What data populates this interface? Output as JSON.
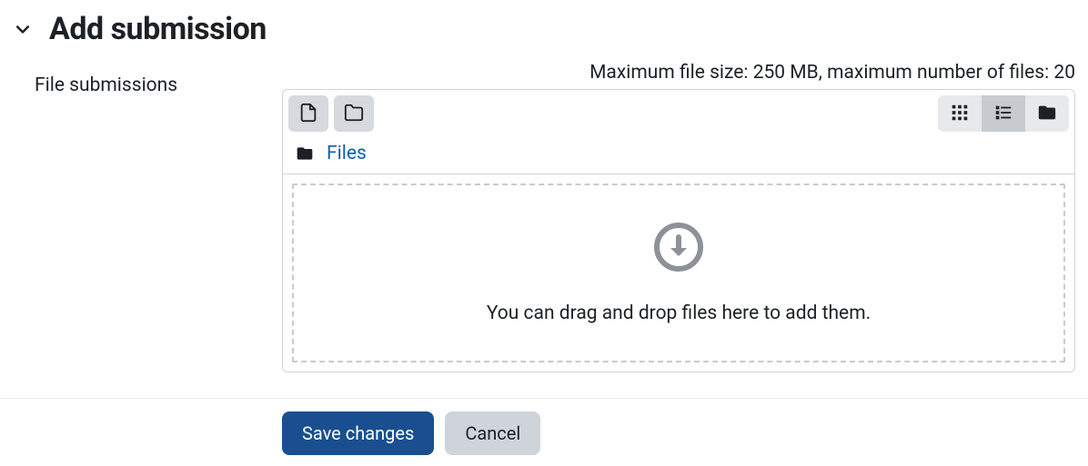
{
  "header": {
    "title": "Add submission"
  },
  "form": {
    "file_submissions_label": "File submissions",
    "limits_text": "Maximum file size: 250 MB, maximum number of files: 20"
  },
  "filemanager": {
    "breadcrumb_root": "Files",
    "dropzone_text": "You can drag and drop files here to add them."
  },
  "actions": {
    "save_label": "Save changes",
    "cancel_label": "Cancel"
  }
}
